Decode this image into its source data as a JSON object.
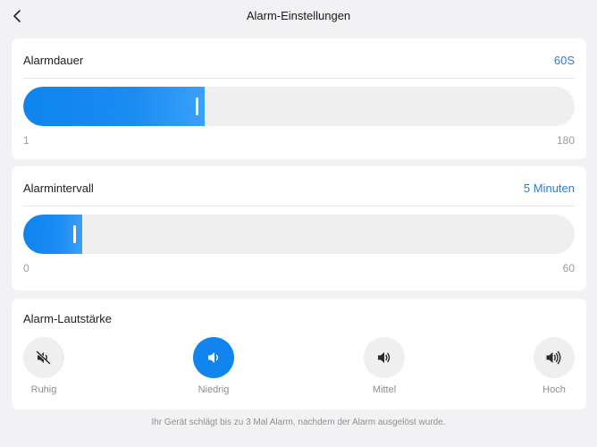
{
  "header": {
    "title": "Alarm-Einstellungen"
  },
  "alarm_duration": {
    "title": "Alarmdauer",
    "value": "60S",
    "min_label": "1",
    "max_label": "180",
    "min": 1,
    "max": 180,
    "current": 60
  },
  "alarm_interval": {
    "title": "Alarmintervall",
    "value": "5 Minuten",
    "min_label": "0",
    "max_label": "60",
    "min": 0,
    "max": 60,
    "current": 5
  },
  "volume": {
    "title": "Alarm-Lautstärke",
    "options": [
      {
        "label": "Ruhig",
        "icon": "mute-icon",
        "selected": false
      },
      {
        "label": "Niedrig",
        "icon": "volume-low-icon",
        "selected": true
      },
      {
        "label": "Mittel",
        "icon": "volume-medium-icon",
        "selected": false
      },
      {
        "label": "Hoch",
        "icon": "volume-high-icon",
        "selected": false
      }
    ]
  },
  "footer": {
    "text": "Ihr Gerät schlägt bis zu 3 Mal Alarm, nachdem der Alarm ausgelöst wurde."
  },
  "colors": {
    "accent": "#1284ee",
    "value_text": "#2f7bd3",
    "background": "#f2f2f4"
  }
}
